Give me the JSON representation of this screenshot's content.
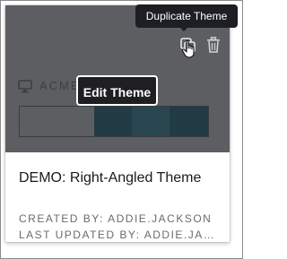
{
  "tooltip": {
    "text": "Duplicate Theme"
  },
  "card": {
    "preview": {
      "brand_text": "ACME",
      "palette_colors": [
        "#5d5e62",
        "#213c45",
        "#2a4650",
        "#213c45"
      ],
      "icons": [
        "monitor-icon",
        "duplicate-icon",
        "trash-icon"
      ]
    },
    "edit_label": "Edit Theme",
    "name": "DEMO: Right-Angled Theme",
    "created_by": "CREATED BY: ADDIE.JACKSON",
    "updated_by": "LAST UPDATED BY: ADDIE.JACKSON"
  }
}
